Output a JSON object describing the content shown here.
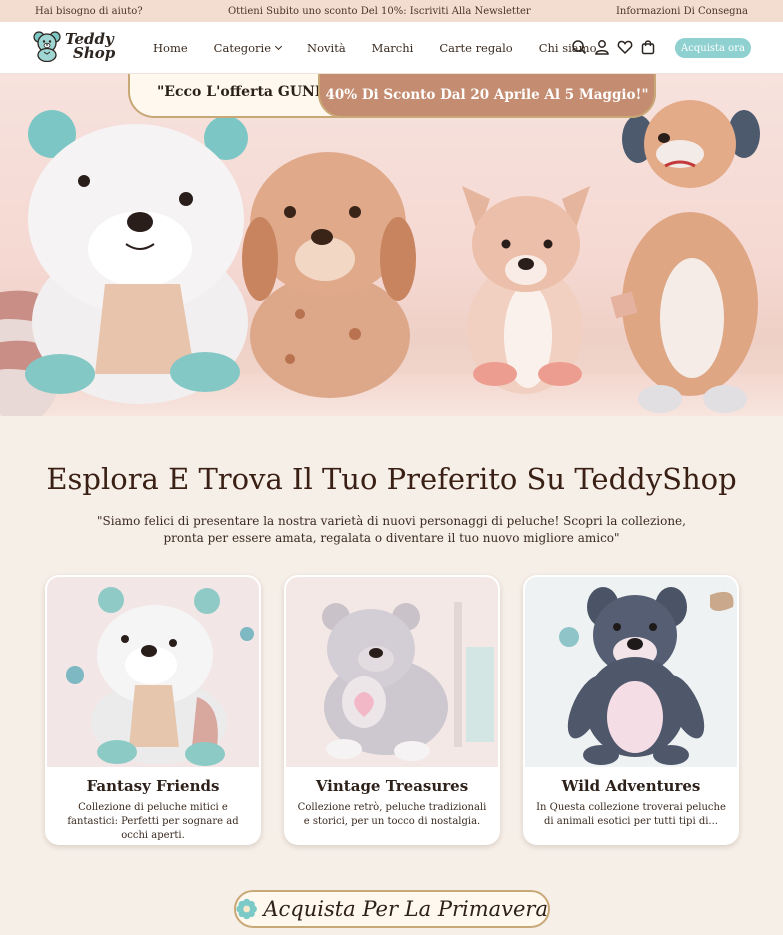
{
  "topbar": {
    "help": "Hai bisogno di aiuto?",
    "newsletter": "Ottieni Subito uno sconto Del 10%: Iscriviti Alla Newsletter",
    "delivery": "Informazioni Di Consegna"
  },
  "brand": {
    "line1": "Teddy",
    "line2": "Shop"
  },
  "nav": {
    "items": [
      "Home",
      "Categorie",
      "Novità",
      "Marchi",
      "Carte regalo",
      "Chi siamo"
    ],
    "cta": "Acquista ora",
    "icons": [
      "search-icon",
      "user-icon",
      "heart-icon",
      "cart-icon"
    ]
  },
  "hero": {
    "promo_left": "\"Ecco L'offerta GUND:",
    "promo_right": "40% Di Sconto Dal 20 Aprile Al 5 Maggio!\""
  },
  "explore": {
    "title": "Esplora E Trova Il Tuo Preferito Su TeddyShop",
    "subtitle": "\"Siamo felici di presentare la nostra varietà di nuovi personaggi di peluche! Scopri la collezione, pronta per essere amata, regalata o diventare il tuo nuovo migliore amico\""
  },
  "cards": [
    {
      "title": "Fantasy Friends",
      "desc": "Collezione di peluche mitici e fantastici: Perfetti per sognare ad occhi aperti."
    },
    {
      "title": "Vintage Treasures",
      "desc": "Collezione retrò, peluche tradizionali e storici, per un tocco di nostalgia."
    },
    {
      "title": "Wild Adventures",
      "desc": "In Questa collezione troverai peluche di animali esotici per tutti tipi di..."
    }
  ],
  "spring": {
    "label": "Acquista Per La Primavera"
  },
  "colors": {
    "accent": "#8fd0d0",
    "promo": "#c48c70",
    "gold": "#c9a877",
    "background": "#f6efe8",
    "topbar": "#f3ddd0"
  }
}
